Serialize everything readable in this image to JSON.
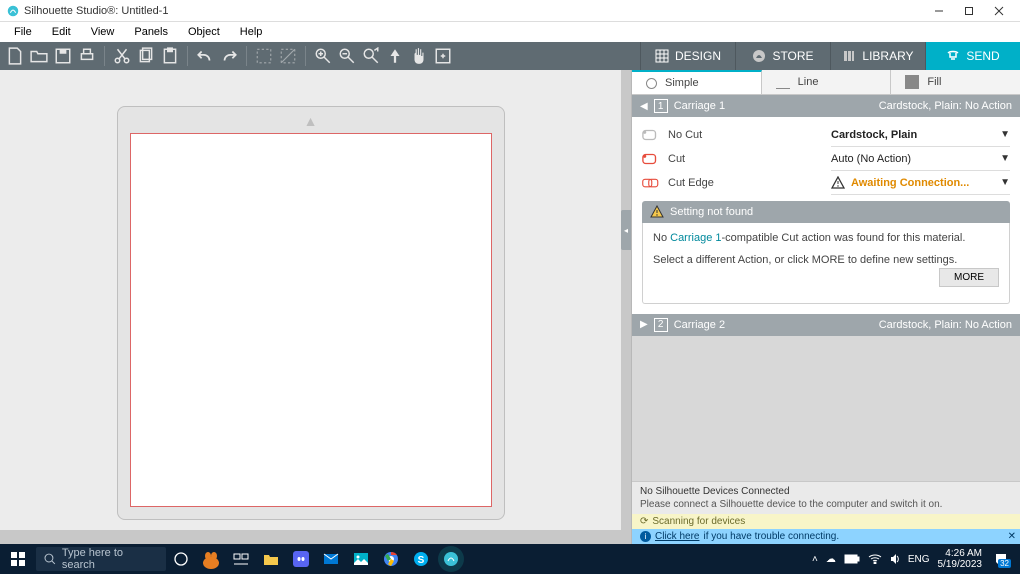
{
  "window": {
    "title": "Silhouette Studio®: Untitled-1"
  },
  "menu": {
    "file": "File",
    "edit": "Edit",
    "view": "View",
    "panels": "Panels",
    "object": "Object",
    "help": "Help"
  },
  "nav": {
    "design": "DESIGN",
    "store": "STORE",
    "library": "LIBRARY",
    "send": "SEND"
  },
  "modes": {
    "simple": "Simple",
    "line": "Line",
    "fill": "Fill"
  },
  "carriage1": {
    "title": "Carriage 1",
    "summary": "Cardstock, Plain: No Action",
    "nocut": "No Cut",
    "cut": "Cut",
    "cutedge": "Cut Edge",
    "material": "Cardstock, Plain",
    "action": "Auto (No Action)",
    "awaiting": "Awaiting Connection..."
  },
  "carriage2": {
    "title": "Carriage 2",
    "summary": "Cardstock, Plain: No Action"
  },
  "snf": {
    "heading": "Setting not found",
    "line1a": "No ",
    "line1link": "Carriage 1",
    "line1b": "-compatible Cut action was found for this material.",
    "line2": "Select a different Action, or click MORE to define new settings.",
    "more": "MORE"
  },
  "devstatus": {
    "heading": "No Silhouette Devices Connected",
    "body": "Please connect a Silhouette device to the computer and switch it on."
  },
  "scan": "Scanning for devices",
  "help": {
    "link": "Click here",
    "rest": " if you have trouble connecting."
  },
  "taskbar": {
    "search_placeholder": "Type here to search",
    "lang": "ENG",
    "time": "4:26 AM",
    "date": "5/19/2023",
    "notif_count": "32"
  }
}
